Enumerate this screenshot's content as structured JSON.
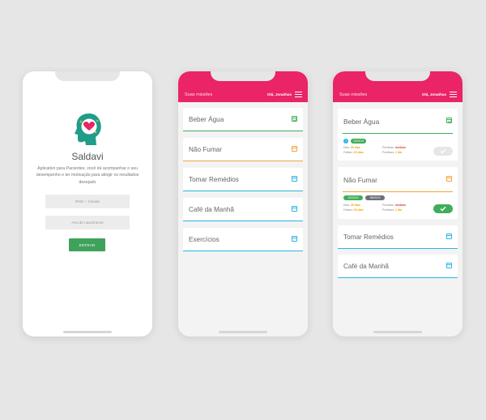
{
  "login": {
    "app_name": "Saldavi",
    "description": "Aplicativo para Pacientes, você irá acompanhar o seu desempenho e ter motivação para atingir os resultados desejado",
    "cpf_placeholder": "RNG + Celular",
    "dob_placeholder": "Ano de nascimento",
    "enter_label": "ENTRAR"
  },
  "header": {
    "title": "Suas missões",
    "user": "Olá, Jonathas"
  },
  "missions": [
    {
      "label": "Beber Água",
      "color": "#3fae5a"
    },
    {
      "label": "Não Fumar",
      "color": "#f2a33a"
    },
    {
      "label": "Tomar Remédios",
      "color": "#29b6e6"
    },
    {
      "label": "Café da Manhã",
      "color": "#29b6e6"
    },
    {
      "label": "Exercícios",
      "color": "#29b6e6"
    }
  ],
  "expanded": {
    "card1": {
      "title": "Beber Água",
      "badge_num": "1",
      "badge_date": "22/03/19",
      "dias_label": "Dias:",
      "dias_value": "30 dias",
      "faltam_label": "Faltam:",
      "faltam_value": "20 dias",
      "perdidas_label": "Perdidas:",
      "perdidas_value": "medium",
      "positivas_label": "Positivas:",
      "positivas_value": "1 dia"
    },
    "card2": {
      "title": "Não Fumar",
      "badge_date1": "22/03/19",
      "badge_date2": "08/09/19",
      "dias_label": "Dias:",
      "dias_value": "30 dias",
      "faltam_label": "Faltam:",
      "faltam_value": "20 dias",
      "perdidas_label": "Perdidas:",
      "perdidas_value": "medium",
      "positivas_label": "Positivas:",
      "positivas_value": "1 dia"
    },
    "card3": {
      "title": "Tomar Remédios"
    },
    "card4": {
      "title": "Café da Manhã"
    }
  },
  "colors": {
    "header": "#ea2466",
    "green": "#3fae5a",
    "orange": "#f2a33a",
    "blue": "#29b6e6"
  }
}
